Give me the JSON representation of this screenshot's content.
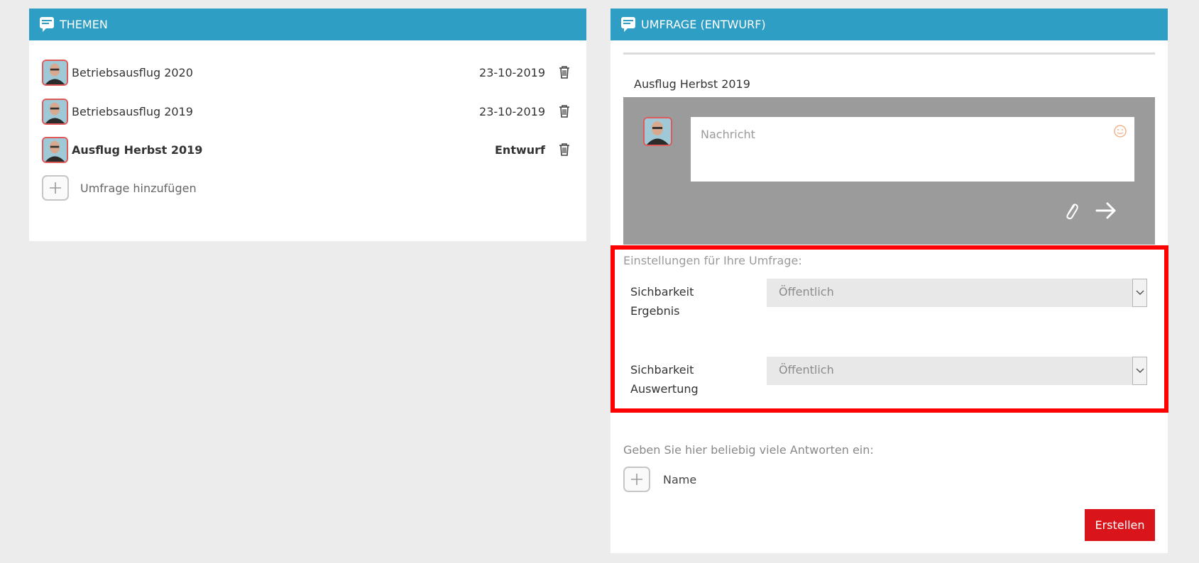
{
  "themes": {
    "header": "THEMEN",
    "topics": [
      {
        "title": "Betriebsausflug 2020",
        "date": "23-10-2019"
      },
      {
        "title": "Betriebsausflug 2019",
        "date": "23-10-2019"
      },
      {
        "title": "Ausflug Herbst 2019",
        "date": "Entwurf"
      }
    ],
    "add_label": "Umfrage hinzufügen"
  },
  "survey": {
    "header": "UMFRAGE (ENTWURF)",
    "title": "Ausflug Herbst 2019",
    "message_placeholder": "Nachricht",
    "settings_caption": "Einstellungen für Ihre Umfrage:",
    "visibility_result_label_1": "Sichbarkeit",
    "visibility_result_label_2": "Ergebnis",
    "visibility_result_value": "Öffentlich",
    "visibility_eval_label_1": "Sichbarkeit",
    "visibility_eval_label_2": "Auswertung",
    "visibility_eval_value": "Öffentlich",
    "answers_caption": "Geben Sie hier beliebig viele Antworten ein:",
    "answer_add_label": "Name",
    "create_label": "Erstellen"
  },
  "colors": {
    "header_blue": "#2e9ec4",
    "highlight_red": "#ff0000",
    "button_red": "#d9151b",
    "composer_gray": "#9b9b9b"
  },
  "icons": [
    "chat-icon",
    "trash-icon",
    "plus-icon",
    "avatar",
    "smiley-icon",
    "paperclip-icon",
    "arrow-right-icon",
    "chevron-down-icon"
  ]
}
